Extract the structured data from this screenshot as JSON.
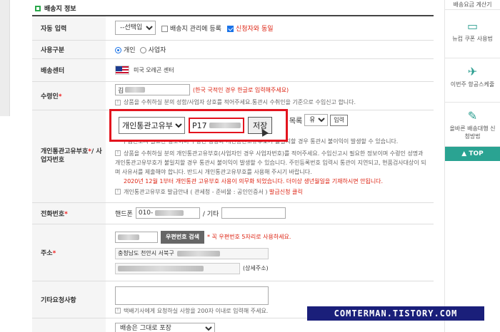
{
  "section": {
    "title": "배송지 정보"
  },
  "rows": {
    "auto_input": {
      "label": "자동 입력",
      "select_value": "--선택입력--",
      "register_label": "배송지 관리에 등록",
      "same_as_applicant": "신청자와 동일"
    },
    "usage": {
      "label": "사용구분",
      "options": [
        "개인",
        "사업자"
      ]
    },
    "center": {
      "label": "배송센터",
      "name": "미국 오레곤 센터"
    },
    "recipient": {
      "label": "수령인",
      "value": "김",
      "hint": "(한국 국적인 경우 한글로 입력해주세요)",
      "note": "상품을 수취하실 분의 성함/사업자 상호를 적어주세요.통관시 수취인을 기준으로 수입신고 합니다."
    },
    "customs": {
      "label": "개인통관고유부호*/ 사업자번호",
      "label_main": "개인통관고유부호",
      "label_sub": "/ 사업자번호",
      "behind_select": "유부호",
      "list_label": "목록",
      "input_button": "입력",
      "partial_line1": "세요.",
      "partial_line2": "수입신고시 필요한 정보이며 수령인 성명과 개인통관고유부호가 불일치할 경우 통관시 불이익이 발생할 수 있습니다.",
      "note1": "상품을 수취하실 분의 개인통관고유부호(사업자인 경우 사업자번호)를 적어주세요. 수입신고시 필요한 정보이며 수령인 성명과 개인통관고유부호가 불일치할 경우 통관시 불이익이 발생할 수 있습니다. 주민등록번호 입력시 통관이 지연되고, 현품검사대상이 되며 사유서를 제출해야 합니다. 반드시 개인통관고유부호를 사용해 주시기 바랍니다.",
      "notice": "2020년 12월 1부터 개인통관 고유부호 사용이 의무화 되었습니다. 더이상 생년월일을 기재하시면 안됩니다.",
      "issue_guide": "개인통관고유부호 발급안내",
      "issue_detail": "( 관세청 - 준비물 : 공인인증서 )",
      "issue_link": "발급신청 클릭"
    },
    "phone": {
      "label": "전화번호",
      "mobile_label": "핸드폰",
      "mobile_value": "010-",
      "other_label": "/ 기타"
    },
    "address": {
      "label": "주소",
      "search_button": "우편번호 검색",
      "zip_hint": "* 꼭 우편번호 5자리로 사용하세요.",
      "line1": "충청남도 천안시 서북구",
      "detail_label": "(상세주소)"
    },
    "request": {
      "label": "기타요청사항",
      "note": "택배기사에게 요청하실 사항을 200자 이내로 입력해 주세요."
    },
    "packing": {
      "select_value": "배송은 그대로 포장"
    }
  },
  "highlight": {
    "select_value": "개인통관고유부호",
    "code_value": "P17",
    "save_button": "저장"
  },
  "sidebar": {
    "items": [
      {
        "label": "배송요금 계산기",
        "icon": "calculator-icon"
      },
      {
        "label": "뉴컵 쿠폰 사용법",
        "icon": "coupon-icon"
      },
      {
        "label": "이번주 항공스케줄",
        "icon": "airplane-icon"
      },
      {
        "label": "올바른 배송대행 신청방법",
        "icon": "pencil-icon"
      }
    ],
    "top_button": "▲ TOP"
  },
  "watermark": "COMTERMAN.TISTORY.COM",
  "colors": {
    "accent_green": "#2aa84a",
    "teal": "#2aa392",
    "highlight_red": "#e3141e",
    "watermark_bg": "#1a1f7a"
  }
}
